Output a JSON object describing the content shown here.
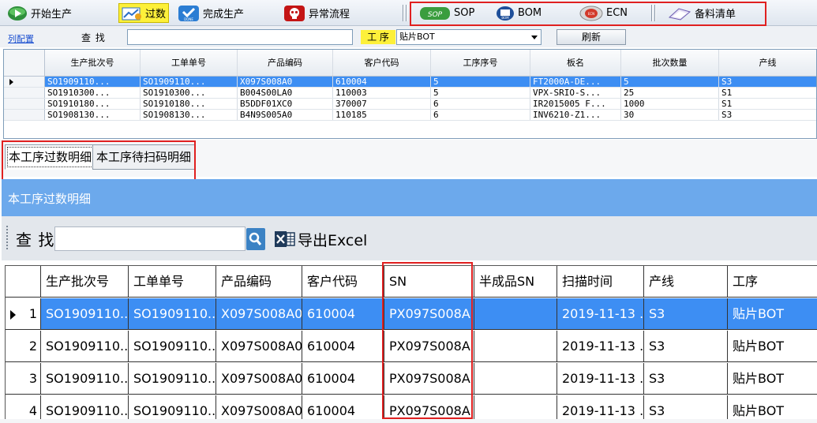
{
  "toolbar": {
    "start_production": "开始生产",
    "pass_count": "过数",
    "finish_production": "完成生产",
    "exception_flow": "异常流程",
    "sop": "SOP",
    "bom": "BOM",
    "ecn": "ECN",
    "material_list": "备料清单",
    "sop_icon_text": "SOP",
    "bom_icon_text": "BOM",
    "ecn_icon_text": "ECN",
    "done_icon_text": "DONE"
  },
  "filter_bar": {
    "column_config": "列配置",
    "search_label": "查 找",
    "search_value": "",
    "process_label": "工 序",
    "process_value": "贴片BOT",
    "refresh": "刷新"
  },
  "batch_grid": {
    "columns": [
      "生产批次号",
      "工单单号",
      "产品编码",
      "客户代码",
      "工序序号",
      "板名",
      "批次数量",
      "产线"
    ],
    "rows": [
      [
        "SO1909110...",
        "SO1909110...",
        "X097S008A0",
        "610004",
        "5",
        "FT2000A-DE...",
        "5",
        "S3"
      ],
      [
        "SO1910300...",
        "SO1910300...",
        "B004S00LA0",
        "110003",
        "5",
        "VPX-SRIO-S...",
        "25",
        "S1"
      ],
      [
        "SO1910180...",
        "SO1910180...",
        "B5DDF01XC0",
        "370007",
        "6",
        "IR2015005 F...",
        "1000",
        "S1"
      ],
      [
        "SO1908130...",
        "SO1908130...",
        "B4N9S005A0",
        "110185",
        "6",
        "INV6210-Z1...",
        "30",
        "S3"
      ]
    ],
    "selected_row": 0
  },
  "tabs": {
    "passed_detail": "本工序过数明细",
    "pending_scan_detail": "本工序待扫码明细"
  },
  "panel": {
    "title": "本工序过数明细",
    "search_label": "查 找",
    "search_value": "",
    "export_excel": "导出Excel"
  },
  "detail_grid": {
    "columns": [
      "生产批次号",
      "工单单号",
      "产品编码",
      "客户代码",
      "SN",
      "半成品SN",
      "扫描时间",
      "产线",
      "工序"
    ],
    "rows": [
      [
        "1",
        "SO1909110...",
        "SO1909110...",
        "X097S008A0",
        "610004",
        "PX097S008A...",
        "",
        "2019-11-13 ...",
        "S3",
        "贴片BOT"
      ],
      [
        "2",
        "SO1909110...",
        "SO1909110...",
        "X097S008A0",
        "610004",
        "PX097S008A...",
        "",
        "2019-11-13 ...",
        "S3",
        "贴片BOT"
      ],
      [
        "3",
        "SO1909110...",
        "SO1909110...",
        "X097S008A0",
        "610004",
        "PX097S008A...",
        "",
        "2019-11-13 ...",
        "S3",
        "贴片BOT"
      ],
      [
        "4",
        "SO1909110...",
        "SO1909110...",
        "X097S008A0",
        "610004",
        "PX097S008A...",
        "",
        "2019-11-13 ...",
        "S3",
        "贴片BOT"
      ]
    ],
    "selected_row": 0
  },
  "colors": {
    "highlight_yellow": "#fdf03a",
    "selection_blue": "#3d8ef3",
    "panel_blue": "#6ca9ec",
    "annotation_red": "#e02020"
  },
  "icons": {
    "start_production": "play-icon",
    "pass_count": "chart-icon",
    "finish_production": "done-check-icon",
    "exception_flow": "skull-icon",
    "sop": "sop-icon",
    "bom": "bom-icon",
    "ecn": "ecn-icon",
    "material_list": "book-icon",
    "search": "search-icon",
    "export": "excel-icon"
  }
}
